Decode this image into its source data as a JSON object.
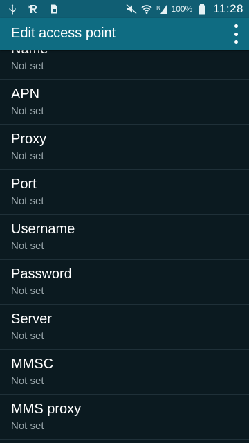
{
  "status_bar": {
    "icons_left": [
      "usb-icon",
      "r-icon",
      "sim-card-icon"
    ],
    "icons_right": [
      "mute-icon",
      "wifi-icon",
      "signal-icon"
    ],
    "battery_percent": "100%",
    "time": "11:28"
  },
  "action_bar": {
    "title": "Edit access point",
    "overflow_icon": "more-vert-icon"
  },
  "items": [
    {
      "title": "Name",
      "summary": "Not set"
    },
    {
      "title": "APN",
      "summary": "Not set"
    },
    {
      "title": "Proxy",
      "summary": "Not set"
    },
    {
      "title": "Port",
      "summary": "Not set"
    },
    {
      "title": "Username",
      "summary": "Not set"
    },
    {
      "title": "Password",
      "summary": "Not set"
    },
    {
      "title": "Server",
      "summary": "Not set"
    },
    {
      "title": "MMSC",
      "summary": "Not set"
    },
    {
      "title": "MMS proxy",
      "summary": "Not set"
    }
  ],
  "colors": {
    "status_bar": "#105e73",
    "action_bar": "#0f6c82",
    "background": "#0b1a20",
    "summary_text": "#9aa6ab"
  }
}
